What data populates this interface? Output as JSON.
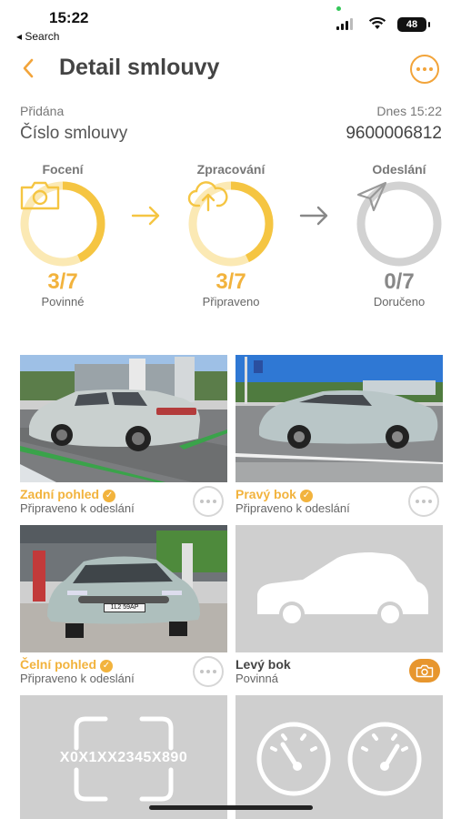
{
  "status_bar": {
    "time": "15:22",
    "back_app": "◂ Search",
    "battery": "48"
  },
  "header": {
    "title": "Detail smlouvy",
    "back_icon": "chevron-left-icon",
    "more_icon": "more-horizontal-icon"
  },
  "contract": {
    "added_label": "Přidána",
    "added_time": "Dnes 15:22",
    "number_label": "Číslo smlouvy",
    "number": "9600006812"
  },
  "steps": [
    {
      "title": "Focení",
      "count": "3/7",
      "sub": "Povinné",
      "icon": "camera-icon",
      "progress": 0.4286,
      "color": "#f5c542"
    },
    {
      "title": "Zpracování",
      "count": "3/7",
      "sub": "Připraveno",
      "icon": "cloud-upload-icon",
      "progress": 0.4286,
      "color": "#f5c542"
    },
    {
      "title": "Odeslání",
      "count": "0/7",
      "sub": "Doručeno",
      "icon": "send-icon",
      "progress": 0,
      "color": "#c8c8c8"
    }
  ],
  "tiles": [
    {
      "label": "Zadní pohled",
      "status": "Připraveno k odeslání",
      "state": "ready"
    },
    {
      "label": "Pravý bok",
      "status": "Připraveno k odeslání",
      "state": "ready"
    },
    {
      "label": "Čelní pohled",
      "status": "Připraveno k odeslání",
      "state": "ready",
      "plate": "1L2 59AP"
    },
    {
      "label": "Levý bok",
      "status": "Povinná",
      "state": "required"
    },
    {
      "vin_placeholder": "X0X1XX2345X890"
    },
    {
      "icon": "gauge-icon"
    }
  ],
  "colors": {
    "accent": "#f2a43a",
    "ready_label": "#f2b33d",
    "placeholder_bg": "#cfcfcf"
  }
}
